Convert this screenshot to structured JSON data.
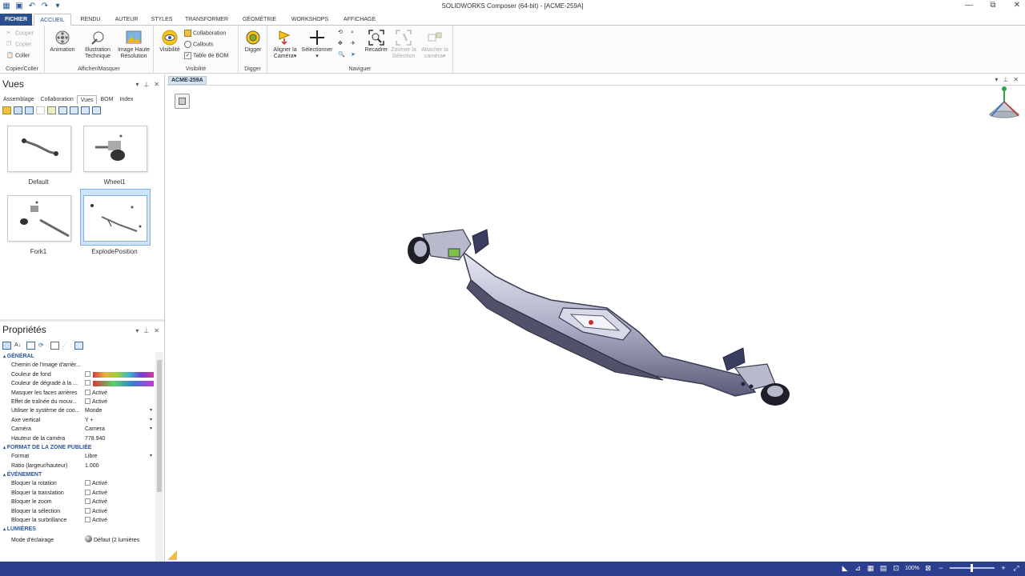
{
  "window": {
    "title": "SOLIDWORKS Composer (64-bit) - [ACME-259A]",
    "controls": {
      "minimize": "—",
      "restore": "⧉",
      "close": "✕"
    }
  },
  "ribbon_tabs": [
    {
      "label": "FICHIER"
    },
    {
      "label": "ACCUEIL"
    },
    {
      "label": "RENDU"
    },
    {
      "label": "AUTEUR"
    },
    {
      "label": "STYLES"
    },
    {
      "label": "TRANSFORMER"
    },
    {
      "label": "GÉOMÉTRIE"
    },
    {
      "label": "WORKSHOPS"
    },
    {
      "label": "AFFICHAGE"
    }
  ],
  "ribbon": {
    "clipboard": {
      "cut": "Couper",
      "copy": "Copier",
      "paste": "Coller",
      "group": "Copier/Coller"
    },
    "show_hide": {
      "animation": "Animation",
      "illustration_l1": "Illustration",
      "illustration_l2": "Technique",
      "hires_l1": "Image Haute",
      "hires_l2": "Résolution",
      "group": "Afficher/Masquer"
    },
    "visibility": {
      "visibility": "Visibilité",
      "collaboration": "Collaboration",
      "callouts": "Callouts",
      "bom_table": "Table de BOM",
      "group": "Visibilité"
    },
    "digger": {
      "digger": "Digger",
      "group": "Digger"
    },
    "navigate": {
      "align_l1": "Aligner la",
      "align_l2": "Caméra",
      "select": "Sélectionner",
      "reframe": "Recadrer",
      "zoom_l1": "Zoomer la",
      "zoom_l2": "Sélection",
      "attach_l1": "Attacher la",
      "attach_l2": "caméra",
      "group": "Naviguer"
    }
  },
  "views_panel": {
    "title": "Vues",
    "tabs": [
      {
        "label": "Assemblage"
      },
      {
        "label": "Collaboration"
      },
      {
        "label": "Vues"
      },
      {
        "label": "BOM"
      },
      {
        "label": "Index"
      }
    ],
    "thumbnails": [
      {
        "label": "Default"
      },
      {
        "label": "Wheel1"
      },
      {
        "label": "Fork1"
      },
      {
        "label": "ExplodePosition"
      }
    ]
  },
  "properties_panel": {
    "title": "Propriétés",
    "sections": {
      "general": "GÉNÉRAL",
      "published_area": "FORMAT DE LA ZONE PUBLIÉE",
      "event": "ÉVÉNEMENT",
      "lights": "LUMIÈRES"
    },
    "general_rows": [
      {
        "key": "Chemin de l'image d'arrièr...",
        "value": ""
      },
      {
        "key": "Couleur de fond",
        "value": ""
      },
      {
        "key": "Couleur de dégradé à la ...",
        "value": ""
      },
      {
        "key": "Masquer les faces arrières",
        "value": "Activé"
      },
      {
        "key": "Effet de traînée du mouv...",
        "value": "Activé"
      },
      {
        "key": "Utiliser le système de coo...",
        "value": "Monde"
      },
      {
        "key": "Axe vertical",
        "value": "Y +"
      },
      {
        "key": "Caméra",
        "value": "Camera"
      },
      {
        "key": "Hauteur de la caméra",
        "value": "778.940"
      }
    ],
    "published_rows": [
      {
        "key": "Format",
        "value": "Libre"
      },
      {
        "key": "Ratio (largeur/hauteur)",
        "value": "1.000"
      }
    ],
    "event_rows": [
      {
        "key": "Bloquer la rotation",
        "value": "Activé"
      },
      {
        "key": "Bloquer la translation",
        "value": "Activé"
      },
      {
        "key": "Bloquer le zoom",
        "value": "Activé"
      },
      {
        "key": "Bloquer la sélection",
        "value": "Activé"
      },
      {
        "key": "Bloquer la surbrillance",
        "value": "Activé"
      }
    ],
    "light_rows": [
      {
        "key": "Mode d'éclairage",
        "value": "Défaut (2 lumières"
      }
    ]
  },
  "document": {
    "tab": "ACME-259A"
  },
  "statusbar": {
    "zoom": "100%"
  },
  "colors": {
    "file_tab": "#2b4f8e",
    "statusbar": "#2b3f8e",
    "accent": "#2b579a",
    "selection": "#cfe3f7"
  }
}
